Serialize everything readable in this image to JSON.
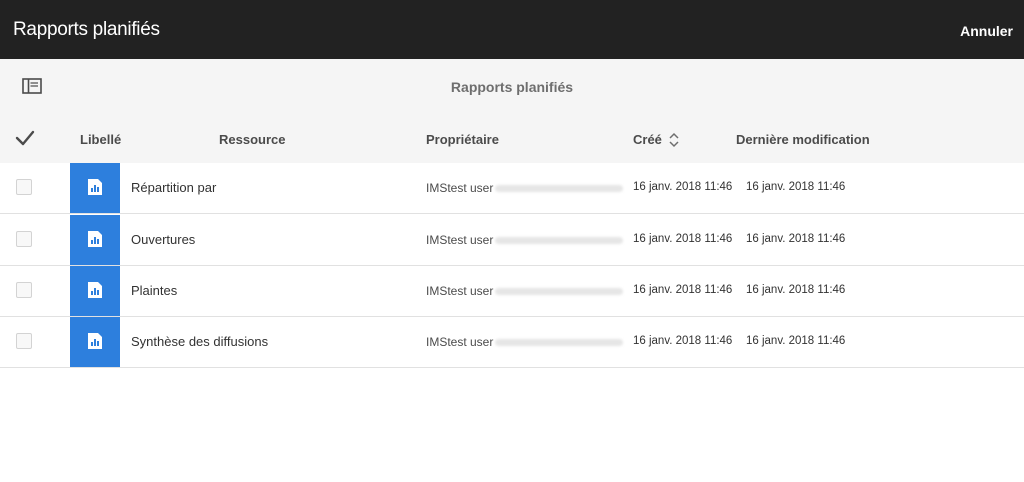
{
  "header": {
    "title": "Rapports planifiés",
    "cancel_label": "Annuler"
  },
  "subheader": {
    "title": "Rapports planifiés"
  },
  "table": {
    "columns": {
      "label": "Libellé",
      "resource": "Ressource",
      "owner": "Propriétaire",
      "created": "Créé",
      "modified": "Dernière modification"
    },
    "rows": [
      {
        "label": "Répartition par",
        "owner": "IMStest user",
        "created": "16 janv. 2018 11:46",
        "modified": "16 janv. 2018 11:46"
      },
      {
        "label": "Ouvertures",
        "owner": "IMStest user",
        "created": "16 janv. 2018 11:46",
        "modified": "16 janv. 2018 11:46"
      },
      {
        "label": "Plaintes",
        "owner": "IMStest user",
        "created": "16 janv. 2018 11:46",
        "modified": "16 janv. 2018 11:46"
      },
      {
        "label": "Synthèse des diffusions",
        "owner": "IMStest user",
        "created": "16 janv. 2018 11:46",
        "modified": "16 janv. 2018 11:46"
      }
    ]
  },
  "icons": {
    "rail_toggle": "rail-toggle-icon",
    "select_all": "checkmark-icon",
    "sort": "sort-icon",
    "report": "report-icon"
  },
  "colors": {
    "topbar_bg": "#222222",
    "thumbnail_bg": "#2d7fdd",
    "subbar_bg": "#f5f5f5"
  }
}
